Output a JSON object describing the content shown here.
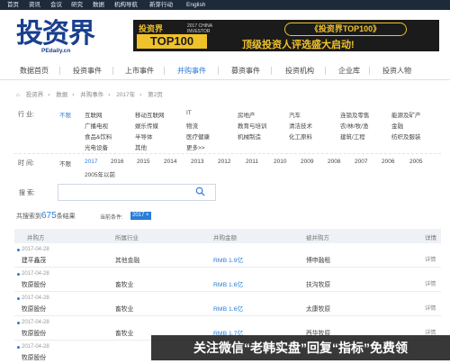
{
  "topnav": [
    "首页",
    "资讯",
    "会议",
    "研究",
    "数据",
    "机构导航",
    "新芽行动",
    "English"
  ],
  "logo": {
    "cn": "投资界",
    "en": "PEdaily.cn"
  },
  "banner": {
    "left_title": "投资界",
    "badge": "TOP100",
    "small": "2017 CHINA INVESTOR",
    "pill": "《投资界TOP100》",
    "sub": "顶级投资人评选盛大启动!"
  },
  "mainnav": [
    "数据首页",
    "投资事件",
    "上市事件",
    "并购事件",
    "募资事件",
    "投资机构",
    "企业库",
    "投资人物"
  ],
  "mainnav_active": 3,
  "breadcrumb": [
    "投资界",
    "数据",
    "并购事件",
    "2017年",
    "第2页"
  ],
  "filters": {
    "industry_label": "行 业:",
    "industry_rows": [
      [
        "不限",
        "互联网",
        "移动互联网",
        "IT",
        "房地产",
        "汽车",
        "连锁及零售",
        "能源及矿产"
      ],
      [
        "广播电视",
        "娱乐传媒",
        "物流",
        "教育与培训",
        "清洁技术",
        "农/林/牧/渔",
        "金融"
      ],
      [
        "食品&饮料",
        "半导体",
        "医疗健康",
        "机械制造",
        "化工原料",
        "建筑/工程",
        "纺织及服装"
      ],
      [
        "光电设备",
        "其他",
        "更多>>"
      ]
    ],
    "time_label": "时 间:",
    "time_rows": [
      [
        "不限",
        "2017",
        "2016",
        "2015",
        "2014",
        "2013",
        "2012",
        "2011",
        "2010",
        "2009",
        "2008",
        "2007",
        "2006",
        "2005"
      ],
      [
        "2005年以前"
      ]
    ]
  },
  "search": {
    "label": "搜 索:",
    "placeholder": ""
  },
  "result": {
    "prefix": "共搜索到",
    "count": "675",
    "suffix": "条结果",
    "cond_label": "当前条件:",
    "cond_tag": "2017 ×"
  },
  "table": {
    "headers": [
      "并购方",
      "所属行业",
      "并购金额",
      "被并购方",
      "详情"
    ],
    "rows": [
      {
        "date": "2017-04-28",
        "name": "建平鑫茂",
        "industry": "其他金融",
        "amount": "RMB 1.9亿",
        "target": "博申融租",
        "detail": "详情"
      },
      {
        "date": "2017-04-28",
        "name": "牧原股份",
        "industry": "畜牧业",
        "amount": "RMB 1.6亿",
        "target": "扶沟牧原",
        "detail": "详情"
      },
      {
        "date": "2017-04-28",
        "name": "牧原股份",
        "industry": "畜牧业",
        "amount": "RMB 1.6亿",
        "target": "太康牧原",
        "detail": "详情"
      },
      {
        "date": "2017-04-28",
        "name": "牧原股份",
        "industry": "畜牧业",
        "amount": "RMB 1.7亿",
        "target": "西华牧原",
        "detail": "详情"
      },
      {
        "date": "2017-04-28",
        "name": "牧原股份",
        "industry": "",
        "amount": "",
        "target": "",
        "detail": ""
      }
    ]
  },
  "watermark": "关注微信“老韩实盘”回复“指标”免费领"
}
